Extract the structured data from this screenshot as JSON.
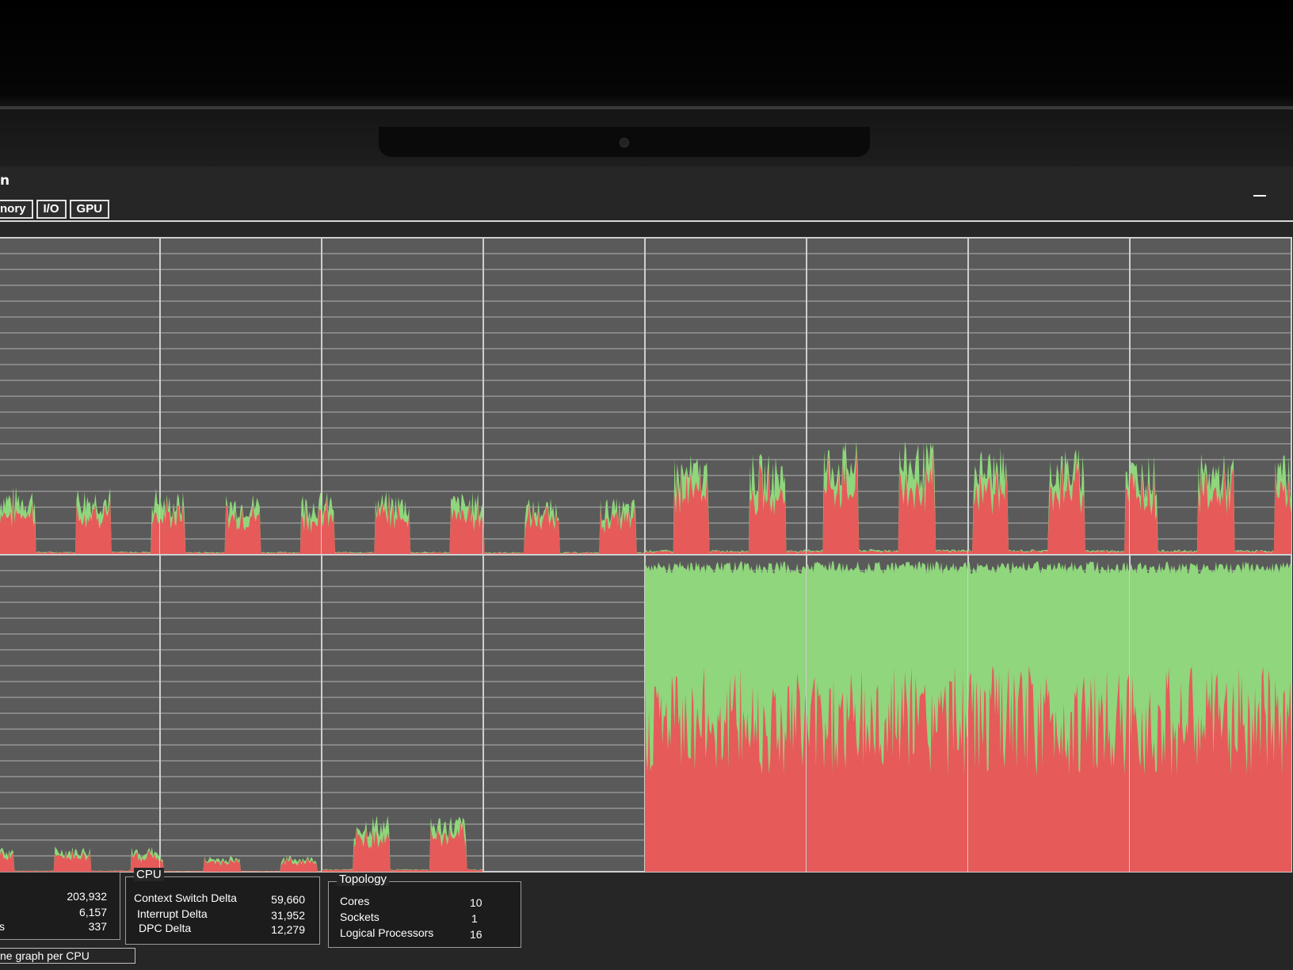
{
  "window": {
    "title": "n"
  },
  "tabs": [
    "nory",
    "I/O",
    "GPU"
  ],
  "graphs": {
    "colors": {
      "kernel": "#e65a5a",
      "user": "#8fd67c",
      "grid": "#cfcfcf",
      "background": "#5a5a5a"
    },
    "cpu_usage": [
      {
        "peak": 0.22,
        "active": true
      },
      {
        "peak": 0.2,
        "active": true
      },
      {
        "peak": 0.2,
        "active": true
      },
      {
        "peak": 0.18,
        "active": true
      },
      {
        "peak": 0.32,
        "active": true
      },
      {
        "peak": 0.36,
        "active": true
      },
      {
        "peak": 0.34,
        "active": true
      },
      {
        "peak": 0.32,
        "active": true
      },
      {
        "peak": 0.08,
        "active": true
      },
      {
        "peak": 0.05,
        "active": true
      },
      {
        "peak": 0.18,
        "active": true
      },
      {
        "peak": 0.0,
        "active": false
      },
      {
        "peak": 0.98,
        "active": true
      },
      {
        "peak": 0.98,
        "active": true
      },
      {
        "peak": 0.98,
        "active": true
      },
      {
        "peak": 0.98,
        "active": true
      }
    ]
  },
  "left_box": {
    "values": [
      "203,932",
      "6,157",
      "337"
    ],
    "partial_label": "s"
  },
  "cpu_box": {
    "title": "CPU",
    "rows": [
      {
        "label": "Context Switch Delta",
        "value": "59,660"
      },
      {
        "label": "Interrupt Delta",
        "value": "31,952"
      },
      {
        "label": "DPC Delta",
        "value": "12,279"
      }
    ]
  },
  "topology_box": {
    "title": "Topology",
    "rows": [
      {
        "label": "Cores",
        "value": "10"
      },
      {
        "label": "Sockets",
        "value": "1"
      },
      {
        "label": "Logical Processors",
        "value": "16"
      }
    ]
  },
  "checkbox": {
    "label": "ne graph per CPU"
  }
}
